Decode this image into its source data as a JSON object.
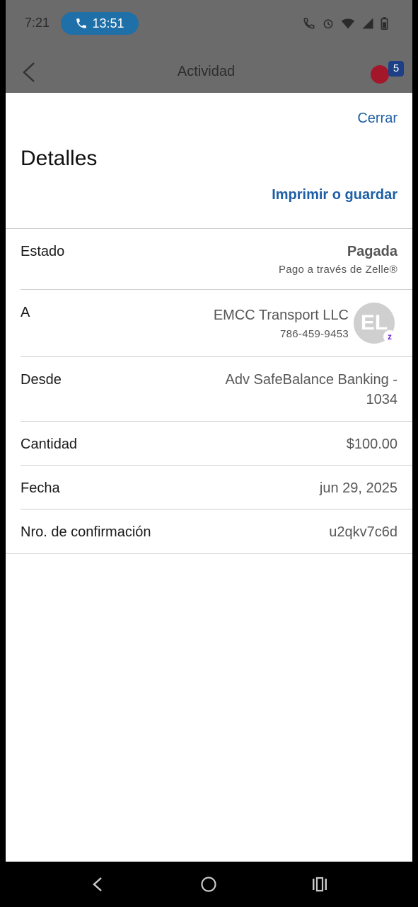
{
  "status_bar": {
    "time": "7:21",
    "call_timer": "13:51",
    "icons": [
      "wifi-call-icon",
      "alarm-icon",
      "wifi-icon",
      "signal-icon",
      "battery-icon"
    ]
  },
  "app_bar": {
    "title": "Actividad",
    "badge_count": "5"
  },
  "sheet": {
    "close_label": "Cerrar",
    "title": "Detalles",
    "print_label": "Imprimir o guardar",
    "rows": {
      "estado": {
        "label": "Estado",
        "value": "Pagada",
        "sub": "Pago a través de Zelle®"
      },
      "to": {
        "label": "A",
        "name": "EMCC Transport LLC",
        "phone": "786-459-9453",
        "avatar_initials": "EL"
      },
      "from": {
        "label": "Desde",
        "line1": "Adv SafeBalance Banking -",
        "line2": "1034"
      },
      "amount": {
        "label": "Cantidad",
        "value": "$100.00"
      },
      "date": {
        "label": "Fecha",
        "value": "jun 29, 2025"
      },
      "confirmation": {
        "label": "Nro. de confirmación",
        "value": "u2qkv7c6d"
      }
    }
  },
  "colors": {
    "link": "#1d5fa5",
    "call_pill": "#1f6fa8",
    "badge": "#1c3f86",
    "zelle": "#6d1ed4"
  }
}
